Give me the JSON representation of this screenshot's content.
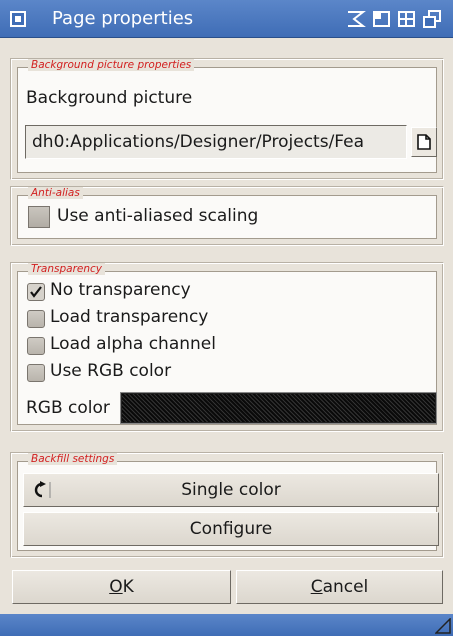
{
  "window": {
    "title": "Page properties"
  },
  "background_group": {
    "label": "Background picture properties",
    "field_label": "Background picture",
    "path_value": "dh0:Applications/Designer/Projects/Fea"
  },
  "antialias_group": {
    "label": "Anti-alias",
    "checkbox_label": "Use anti-aliased scaling",
    "checked": false
  },
  "transparency_group": {
    "label": "Transparency",
    "options": [
      {
        "label": "No transparency",
        "checked": true
      },
      {
        "label": "Load transparency",
        "checked": false
      },
      {
        "label": "Load alpha channel",
        "checked": false
      },
      {
        "label": "Use RGB color",
        "checked": false
      }
    ],
    "rgb_label": "RGB color"
  },
  "backfill_group": {
    "label": "Backfill settings",
    "cycle_value": "Single color",
    "configure_label": "Configure"
  },
  "footer": {
    "ok_rest": "K",
    "ok_key": "O",
    "cancel_key": "C",
    "cancel_rest": "ancel"
  },
  "colors": {
    "titlebar": "#4a78c0",
    "group_label": "#d22020",
    "window_bg": "#e8e3da"
  }
}
